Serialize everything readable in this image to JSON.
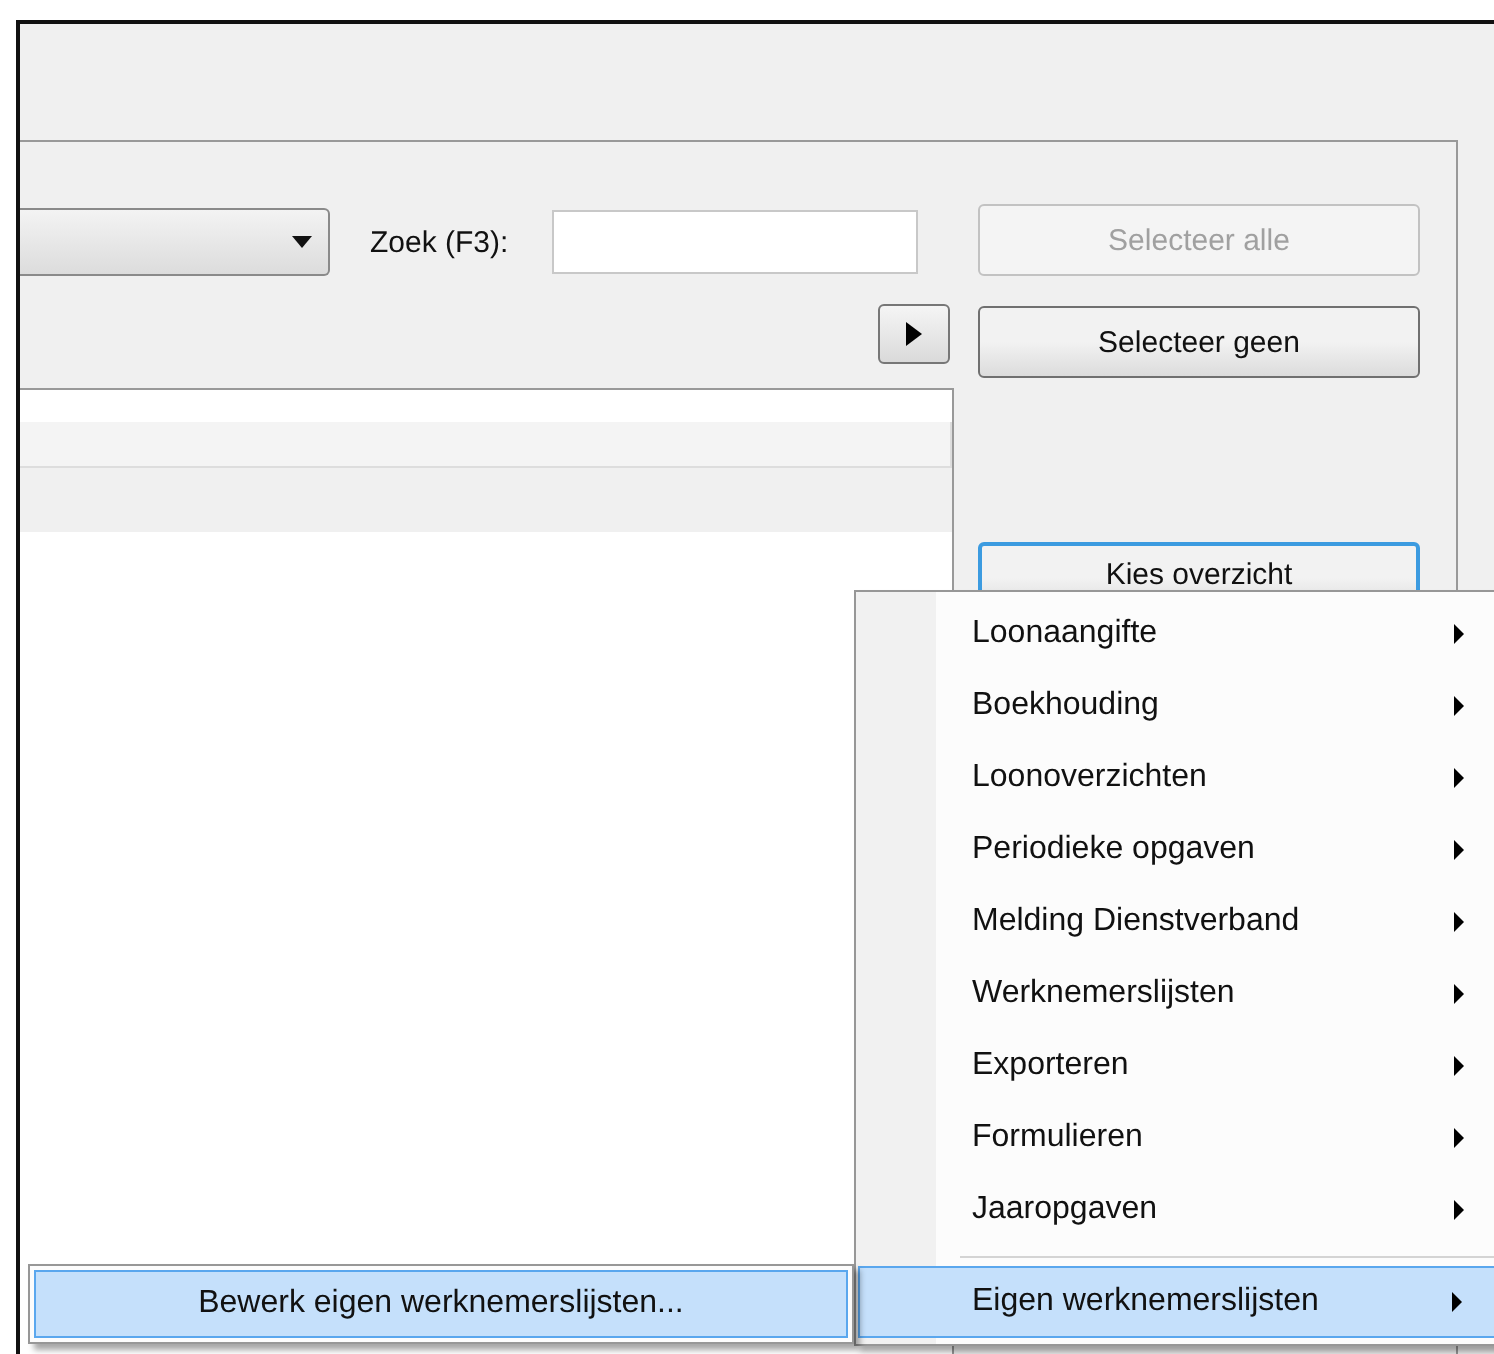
{
  "search": {
    "label": "Zoek (F3):"
  },
  "buttons": [
    {
      "label": "Selecteer alle",
      "disabled": true,
      "focused": false
    },
    {
      "label": "Selecteer geen",
      "disabled": false,
      "focused": false
    },
    {
      "label": "Kies overzicht",
      "disabled": false,
      "focused": true
    }
  ],
  "menu": {
    "items": [
      {
        "kind": "item",
        "label": "Loonaangifte",
        "selected": false
      },
      {
        "kind": "item",
        "label": "Boekhouding",
        "selected": false
      },
      {
        "kind": "item",
        "label": "Loonoverzichten",
        "selected": false
      },
      {
        "kind": "item",
        "label": "Periodieke opgaven",
        "selected": false
      },
      {
        "kind": "item",
        "label": "Melding Dienstverband",
        "selected": false
      },
      {
        "kind": "item",
        "label": "Werknemerslijsten",
        "selected": false
      },
      {
        "kind": "item",
        "label": "Exporteren",
        "selected": false
      },
      {
        "kind": "item",
        "label": "Formulieren",
        "selected": false
      },
      {
        "kind": "item",
        "label": "Jaaropgaven",
        "selected": false
      },
      {
        "kind": "separator"
      },
      {
        "kind": "item",
        "label": "Eigen werknemerslijsten",
        "selected": true
      }
    ]
  },
  "submenu": {
    "items": [
      {
        "label": "Bewerk eigen werknemerslijsten...",
        "selected": true
      }
    ]
  }
}
